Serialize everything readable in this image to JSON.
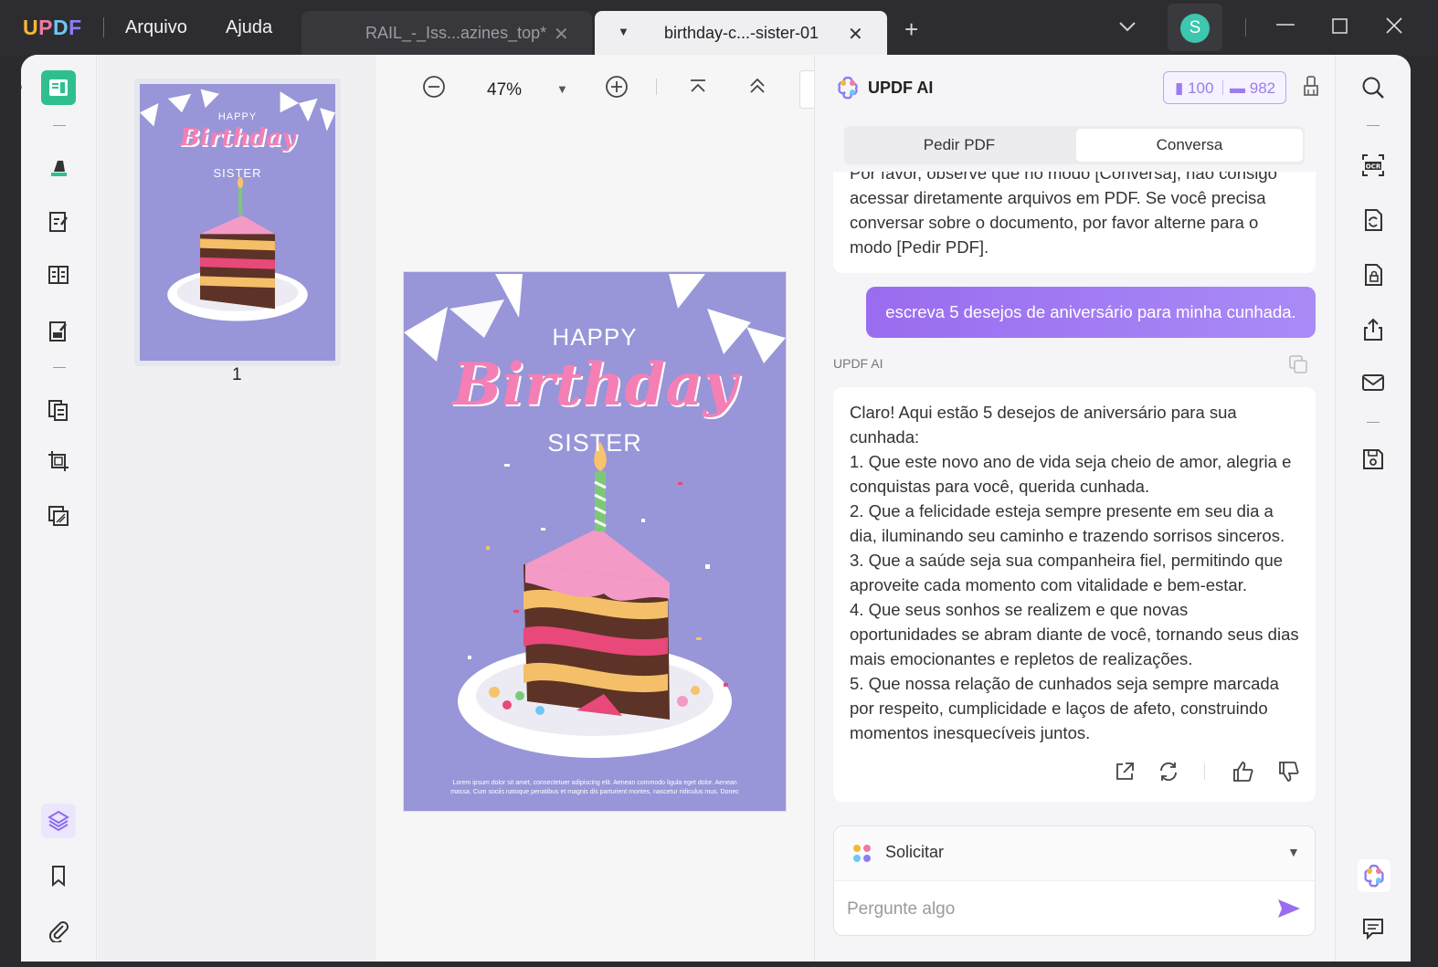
{
  "app": {
    "logo": "UPDF",
    "menu": [
      "Arquivo",
      "Ajuda"
    ]
  },
  "tabs": [
    {
      "title": "RAIL_-_Iss...azines_top*",
      "active": false
    },
    {
      "title": "birthday-c...-sister-01",
      "active": true
    }
  ],
  "user": {
    "initial": "S"
  },
  "toolbar": {
    "zoom": "47%"
  },
  "thumbnails": {
    "page_number": "1"
  },
  "card": {
    "happy": "HAPPY",
    "birthday": "Birthday",
    "sister": "SISTER",
    "footer_line1": "Lorem ipsum dolor sit amet, consectetuer adipiscing elit. Aenean commodo ligula eget dolor. Aenean",
    "footer_line2": "massa. Cum sociis natoque penatibus et magnis dis parturient montes, nascetur ridiculus mus. Donec"
  },
  "ai": {
    "title": "UPDF AI",
    "quota_pdf": "100",
    "quota_chat": "982",
    "mode_pdf": "Pedir PDF",
    "mode_chat": "Conversa",
    "prev_message_partial": "Por favor, observe que no modo [Conversa], não consigo",
    "prev_message": "acessar diretamente arquivos em PDF. Se você precisa conversar sobre o documento, por favor alterne para o modo [Pedir PDF].",
    "user_message": "escreva 5 desejos de aniversário para minha cunhada.",
    "ai_label": "UPDF AI",
    "answer_intro": "Claro! Aqui estão 5 desejos de aniversário para sua cunhada:",
    "answer_items": [
      "1. Que este novo ano de vida seja cheio de amor, alegria e conquistas para você, querida cunhada.",
      "2. Que a felicidade esteja sempre presente em seu dia a dia, iluminando seu caminho e trazendo sorrisos sinceros.",
      "3. Que a saúde seja sua companheira fiel, permitindo que aproveite cada momento com vitalidade e bem-estar.",
      "4. Que seus sonhos se realizem e que novas oportunidades se abram diante de você, tornando seus dias mais emocionantes e repletos de realizações.",
      "5. Que nossa relação de cunhados seja sempre marcada por respeito, cumplicidade e laços de afeto, construindo momentos inesquecíveis juntos."
    ],
    "prompt_mode": "Solicitar",
    "prompt_placeholder": "Pergunte algo"
  },
  "colors": {
    "accent": "#9a6cf0",
    "card_bg": "#9895d8",
    "card_pink": "#f47fb5"
  }
}
